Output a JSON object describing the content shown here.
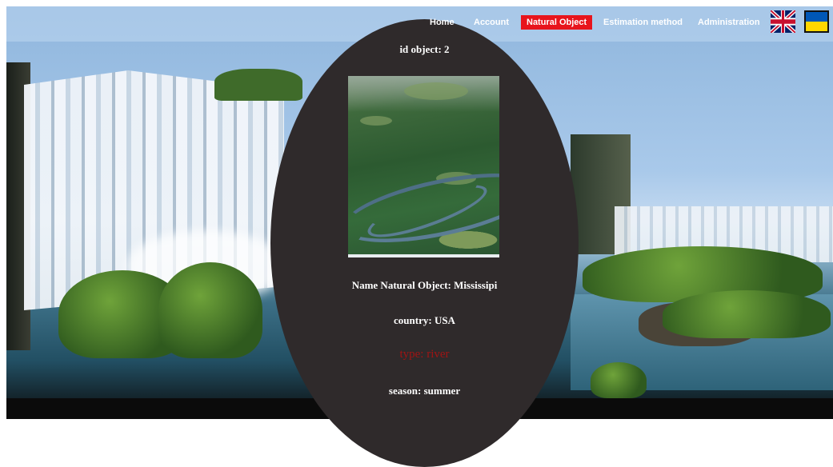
{
  "nav": {
    "home": "Home",
    "account": "Account",
    "natural_object": "Natural Object",
    "estimation_method": "Estimation method",
    "administration": "Administration",
    "active_color": "#e8141c"
  },
  "flags": {
    "english": "uk-flag-icon",
    "ukrainian": "ukraine-flag-icon"
  },
  "object": {
    "id_label": "id object: 2",
    "name_label": "Name Natural Object: Mississipi",
    "country_label": "country: USA",
    "type_label": "type: river",
    "type_color": "#a01414",
    "season_label": "season: summer"
  }
}
